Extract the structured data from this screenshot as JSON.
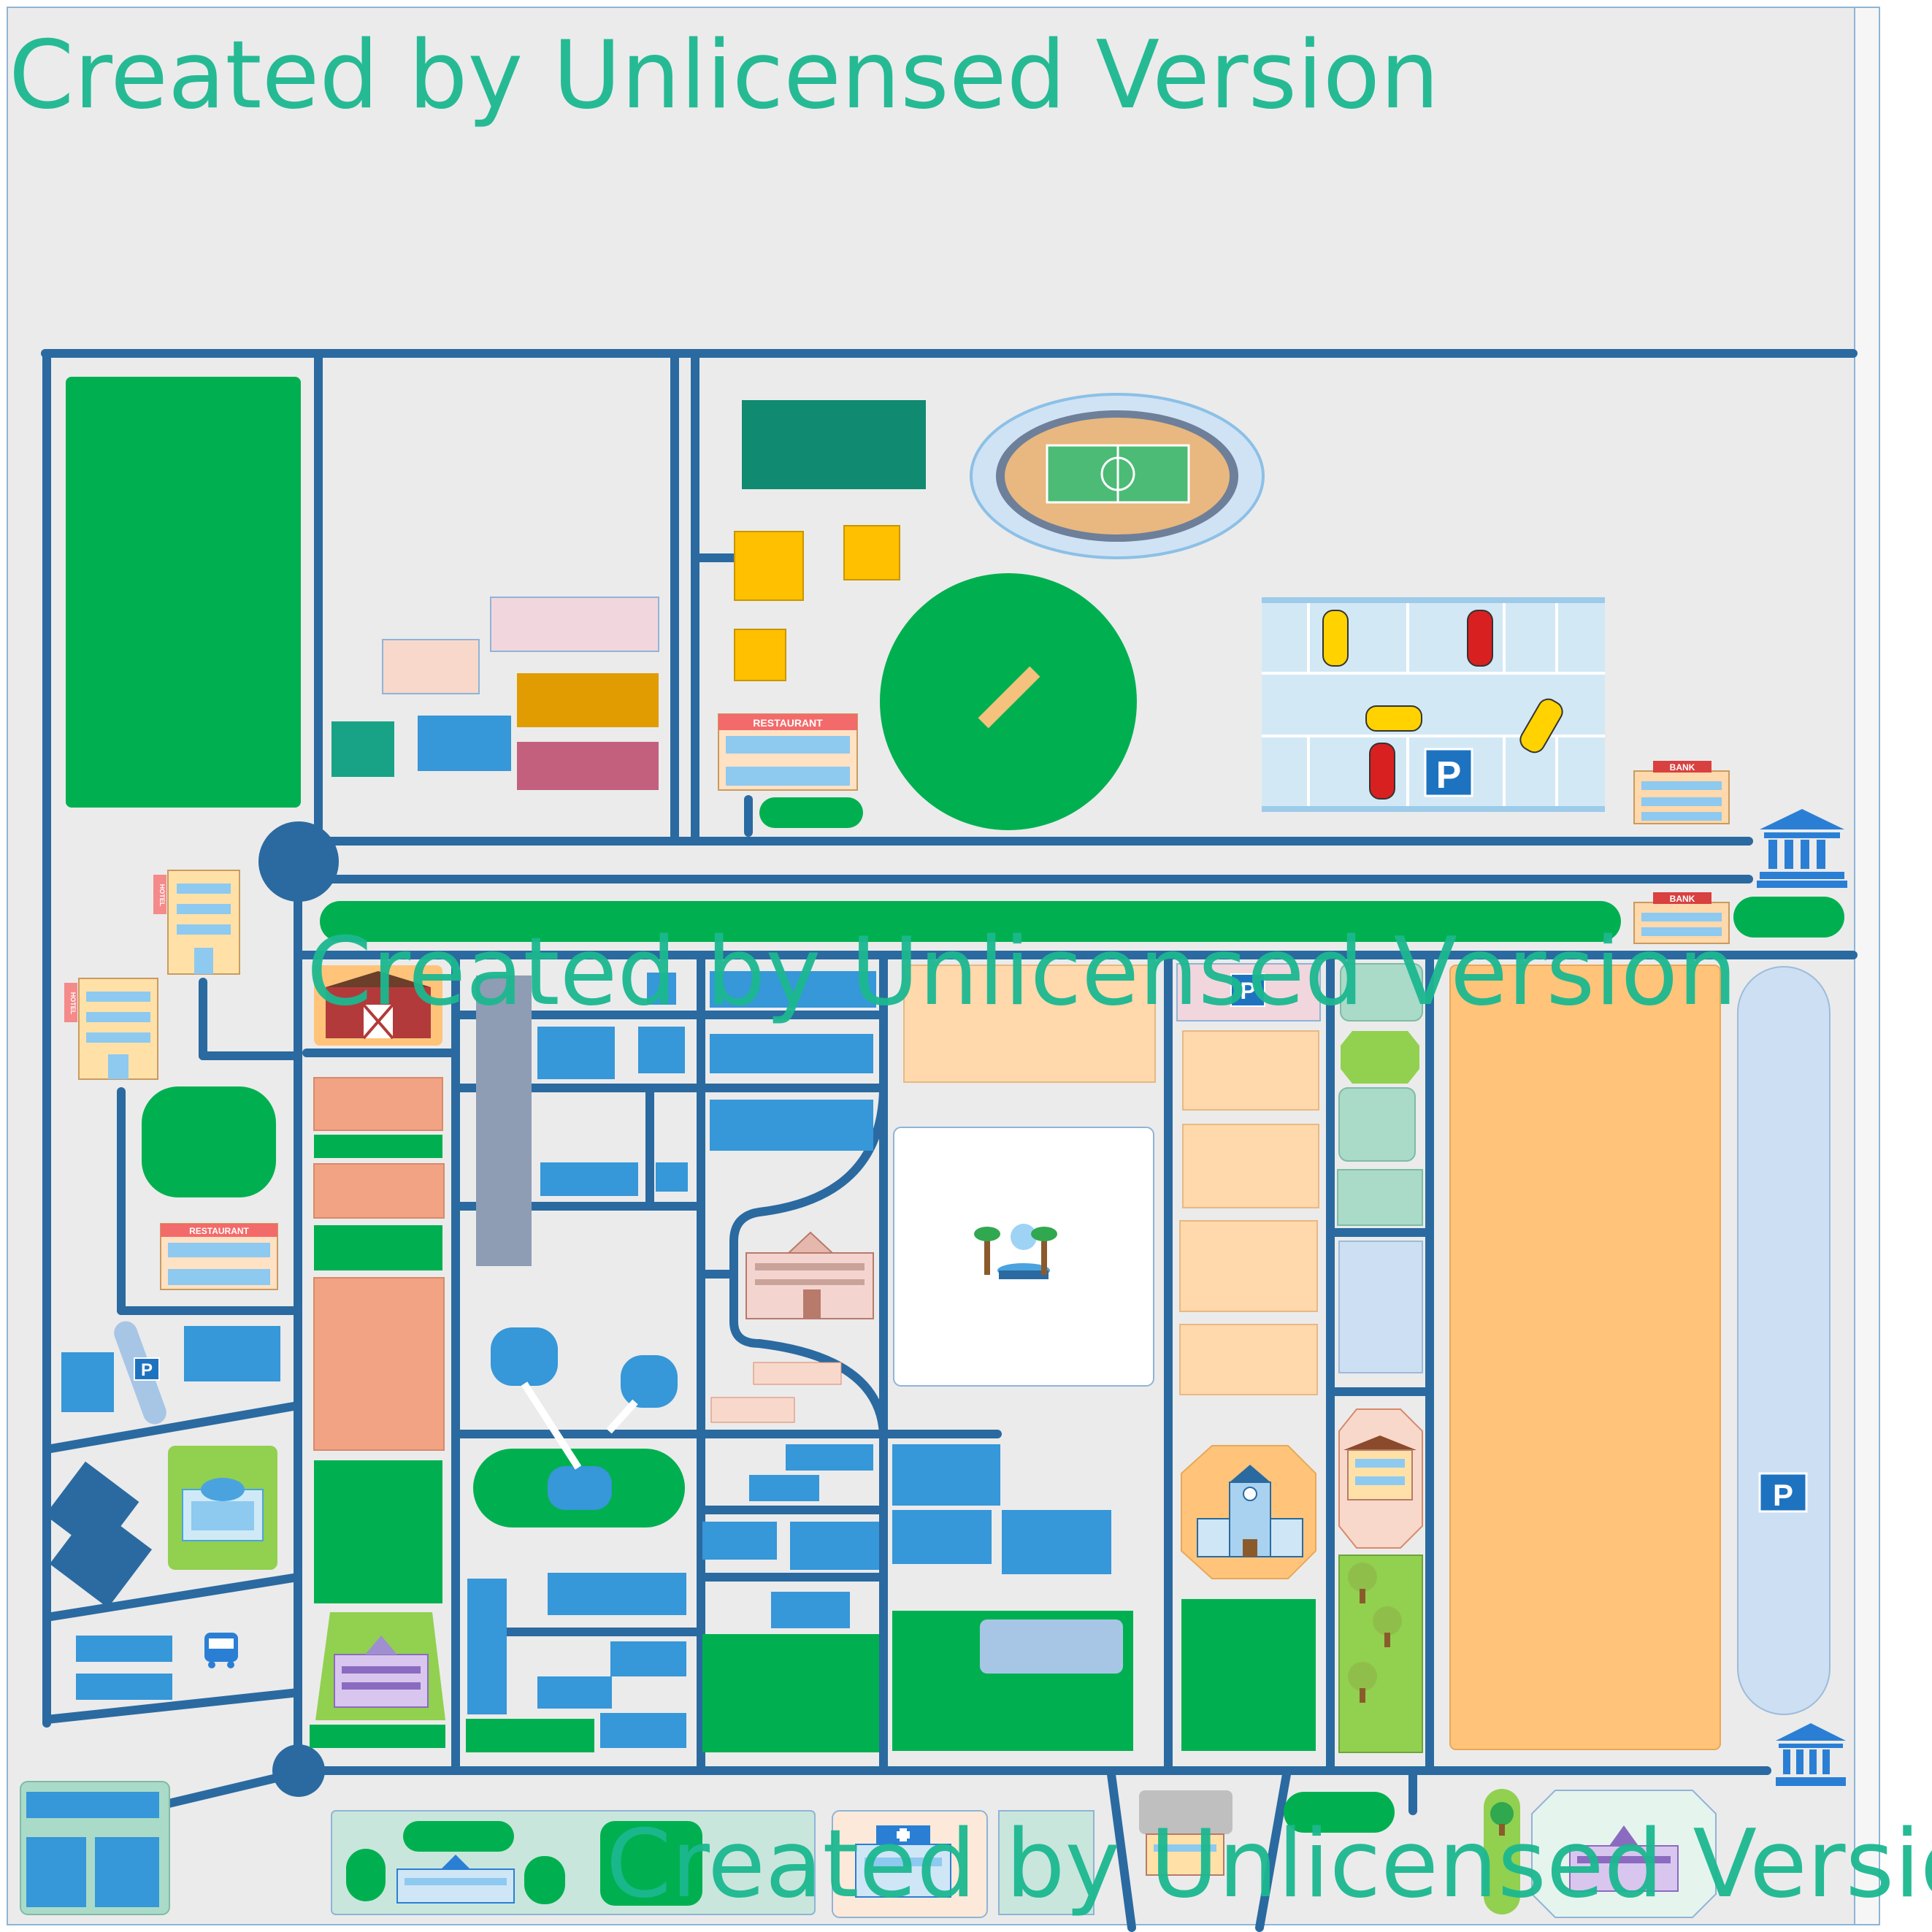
{
  "watermarks": [
    "Created by Unlicensed Version",
    "Created by Unlicensed Version",
    "Created by Unlicensed Version"
  ],
  "signs": {
    "restaurant": "RESTAURANT",
    "bank": "BANK",
    "hotel": "HOTEL",
    "parking": "P"
  },
  "colors": {
    "road": "#2a6aa0",
    "lawn": "#00b050",
    "building_blue": "#3697d9",
    "peach": "#f2a383",
    "orange": "#ffc479",
    "light_orange": "#ffd8ab",
    "amber": "#ffc000",
    "teal": "#118a72",
    "background": "#ebebeb"
  },
  "icons": [
    "stadium-icon",
    "cricket-field-icon",
    "parking-lot-icon",
    "bank-icon",
    "hotel-icon",
    "restaurant-icon",
    "barn-icon",
    "town-hall-icon",
    "fountain-icon",
    "mall-icon",
    "bus-icon",
    "school-icon",
    "hospital-icon",
    "clock-tower-icon",
    "tree-icon",
    "house-icon"
  ]
}
